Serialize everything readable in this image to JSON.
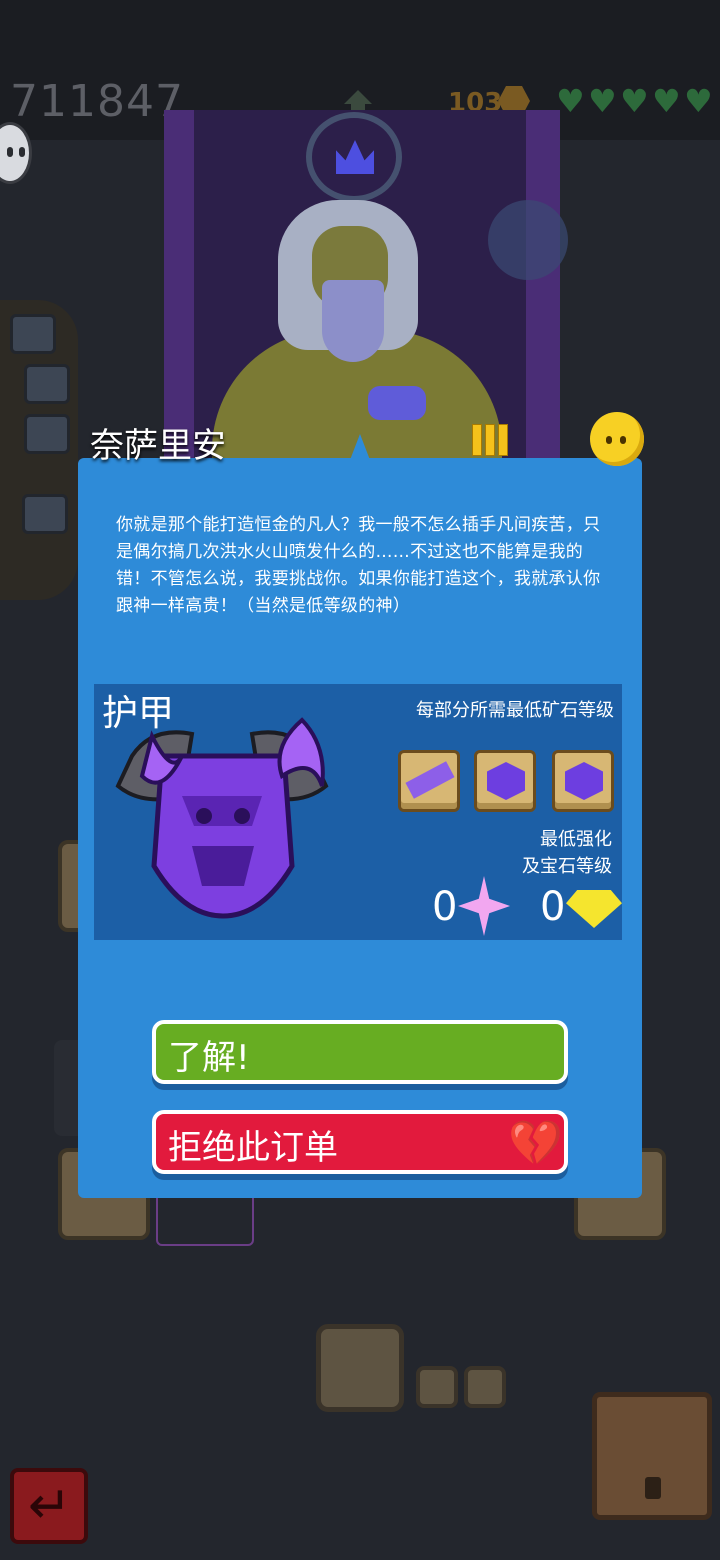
{
  "hud": {
    "score": "711847",
    "gold": "103",
    "hearts": 5
  },
  "npc": {
    "name": "奈萨里安",
    "message": "你就是那个能打造恒金的凡人？我一般不怎么插手凡间疾苦，只是偶尔搞几次洪水火山喷发什么的……不过这也不能算是我的错！不管怎么说，我要挑战你。如果你能打造这个，我就承认你跟神一样高贵！（当然是低等级的神）"
  },
  "order": {
    "item_name": "护甲",
    "requirement_label": "每部分所需最低矿石等级",
    "min_label_line1": "最低强化",
    "min_label_line2": "及宝石等级",
    "enhance_level": "0",
    "gem_level": "0",
    "ores": [
      "bar",
      "gem",
      "gem"
    ]
  },
  "buttons": {
    "accept": "了解!",
    "reject": "拒绝此订单"
  },
  "colors": {
    "dialog": "#2e8bd8",
    "accept": "#67ad22",
    "reject": "#e21a3d"
  }
}
